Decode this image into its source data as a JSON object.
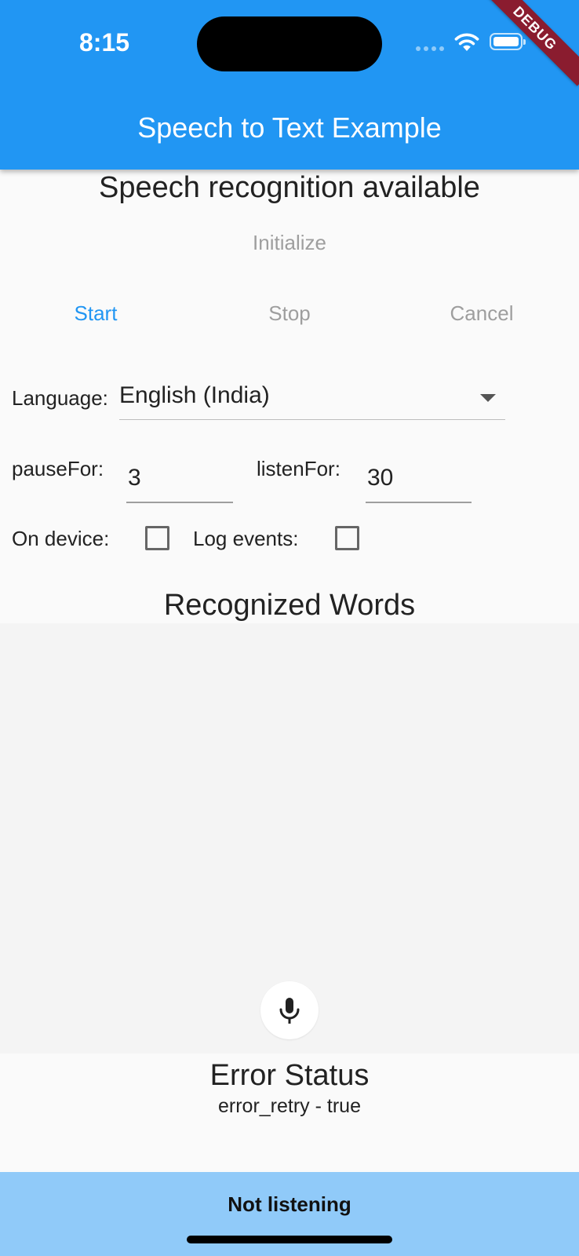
{
  "status_bar": {
    "time": "8:15",
    "debug_label": "DEBUG"
  },
  "app_bar": {
    "title": "Speech to Text Example"
  },
  "availability_text": "Speech recognition available",
  "buttons": {
    "initialize": "Initialize",
    "start": "Start",
    "stop": "Stop",
    "cancel": "Cancel"
  },
  "settings": {
    "language_label": "Language:",
    "language_value": "English (India)",
    "pause_for_label": "pauseFor:",
    "pause_for_value": "3",
    "listen_for_label": "listenFor:",
    "listen_for_value": "30",
    "on_device_label": "On device:",
    "log_events_label": "Log events:"
  },
  "recognized_words": {
    "heading": "Recognized Words"
  },
  "error": {
    "heading": "Error Status",
    "message": "error_retry - true"
  },
  "bottom_status": "Not listening",
  "icons": {
    "mic": "mic-icon",
    "wifi": "wifi-icon",
    "battery": "battery-icon",
    "dropdown": "dropdown-arrow-icon"
  },
  "colors": {
    "app_bar": "#2196f3",
    "primary_text_button": "#2196f3",
    "disabled_text": "#9e9e9e",
    "bottom_bar": "#90caf9",
    "debug_ribbon": "#8a1c2f"
  }
}
